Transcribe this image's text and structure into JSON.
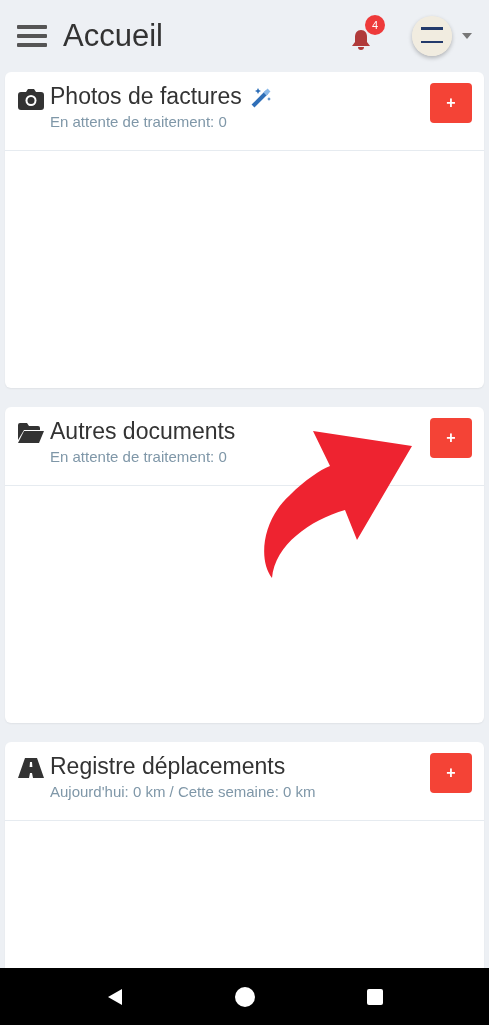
{
  "header": {
    "title": "Accueil",
    "notifications": "4"
  },
  "cards": [
    {
      "kind": "camera",
      "title": "Photos de factures",
      "magic": true,
      "subtitle": "En attente de traitement: 0",
      "add": "+"
    },
    {
      "kind": "folder",
      "title": "Autres documents",
      "magic": false,
      "subtitle": "En attente de traitement: 0",
      "add": "+"
    },
    {
      "kind": "road",
      "title": "Registre déplacements",
      "magic": false,
      "subtitle": "Aujourd'hui: 0 km / Cette semaine: 0 km",
      "add": "+"
    }
  ]
}
